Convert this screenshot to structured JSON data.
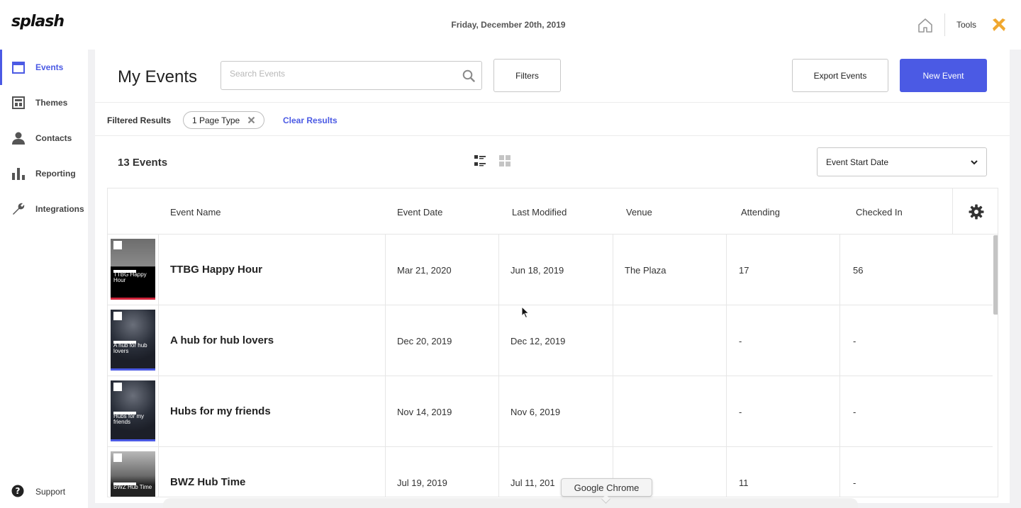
{
  "app": {
    "logo": "splash",
    "date": "Friday, December 20th, 2019",
    "tools_label": "Tools"
  },
  "sidebar": {
    "items": [
      {
        "label": "Events",
        "icon": "calendar-icon",
        "active": true
      },
      {
        "label": "Themes",
        "icon": "layout-icon",
        "active": false
      },
      {
        "label": "Contacts",
        "icon": "person-icon",
        "active": false
      },
      {
        "label": "Reporting",
        "icon": "bar-chart-icon",
        "active": false
      },
      {
        "label": "Integrations",
        "icon": "wrench-icon",
        "active": false
      }
    ],
    "support_label": "Support"
  },
  "header": {
    "title": "My Events",
    "search_placeholder": "Search Events",
    "filters_label": "Filters",
    "export_label": "Export Events",
    "new_event_label": "New Event"
  },
  "filter_bar": {
    "label": "Filtered Results",
    "chip_label": "1 Page Type",
    "clear_label": "Clear Results"
  },
  "list": {
    "count_label": "13 Events",
    "sort_label": "Event Start Date"
  },
  "table": {
    "columns": [
      "Event Name",
      "Event Date",
      "Last Modified",
      "Venue",
      "Attending",
      "Checked In"
    ],
    "rows": [
      {
        "thumb_title": "TTBG Happy Hour",
        "name": "TTBG Happy Hour",
        "event_date": "Mar 21, 2020",
        "last_modified": "Jun 18, 2019",
        "venue": "The Plaza",
        "attending": "17",
        "checked_in": "56",
        "accent": "#d0243b"
      },
      {
        "thumb_title": "A hub for hub lovers",
        "name": "A hub for hub lovers",
        "event_date": "Dec 20, 2019",
        "last_modified": "Dec 12, 2019",
        "venue": "",
        "attending": "-",
        "checked_in": "-",
        "accent": "#4b5ae4"
      },
      {
        "thumb_title": "Hubs for my friends",
        "name": "Hubs for my friends",
        "event_date": "Nov 14, 2019",
        "last_modified": "Nov 6, 2019",
        "venue": "",
        "attending": "-",
        "checked_in": "-",
        "accent": "#4b5ae4"
      },
      {
        "thumb_title": "BWZ Hub Time",
        "name": "BWZ Hub Time",
        "event_date": "Jul 19, 2019",
        "last_modified": "Jul 11, 201",
        "venue": "laza",
        "attending": "11",
        "checked_in": "-",
        "accent": "#4b5ae4"
      }
    ]
  },
  "tooltip": {
    "label": "Google Chrome"
  },
  "colors": {
    "accent": "#4b5ae4",
    "tools_icon": "#f0a830"
  }
}
